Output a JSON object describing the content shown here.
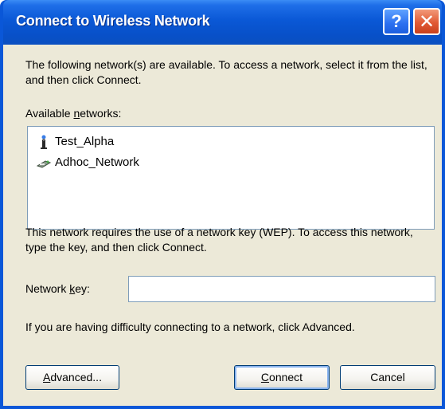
{
  "window": {
    "title": "Connect to Wireless Network",
    "help_button": "?",
    "close_button": "✕"
  },
  "intro_text": "The following network(s) are available. To access a network, select it from the list, and then click Connect.",
  "available_networks": {
    "label_prefix": "Available ",
    "label_underlined": "n",
    "label_suffix": "etworks:",
    "items": [
      {
        "name": "Test_Alpha",
        "icon": "infrastructure-network-icon"
      },
      {
        "name": "Adhoc_Network",
        "icon": "adhoc-network-icon"
      }
    ]
  },
  "requirement_text": "This network requires the use of a network key (WEP). To access this network, type the key, and then click Connect.",
  "network_key": {
    "label_prefix": "Network ",
    "label_underlined": "k",
    "label_suffix": "ey:",
    "value": ""
  },
  "difficulty_text": "If you are having difficulty connecting to a network, click Advanced.",
  "buttons": {
    "advanced": {
      "underlined": "A",
      "rest": "dvanced..."
    },
    "connect": {
      "underlined": "C",
      "rest": "onnect"
    },
    "cancel": {
      "label": "Cancel"
    }
  },
  "colors": {
    "titlebar": "#0a58d6",
    "dialog_background": "#ece9d8",
    "field_border": "#7f9db9"
  }
}
